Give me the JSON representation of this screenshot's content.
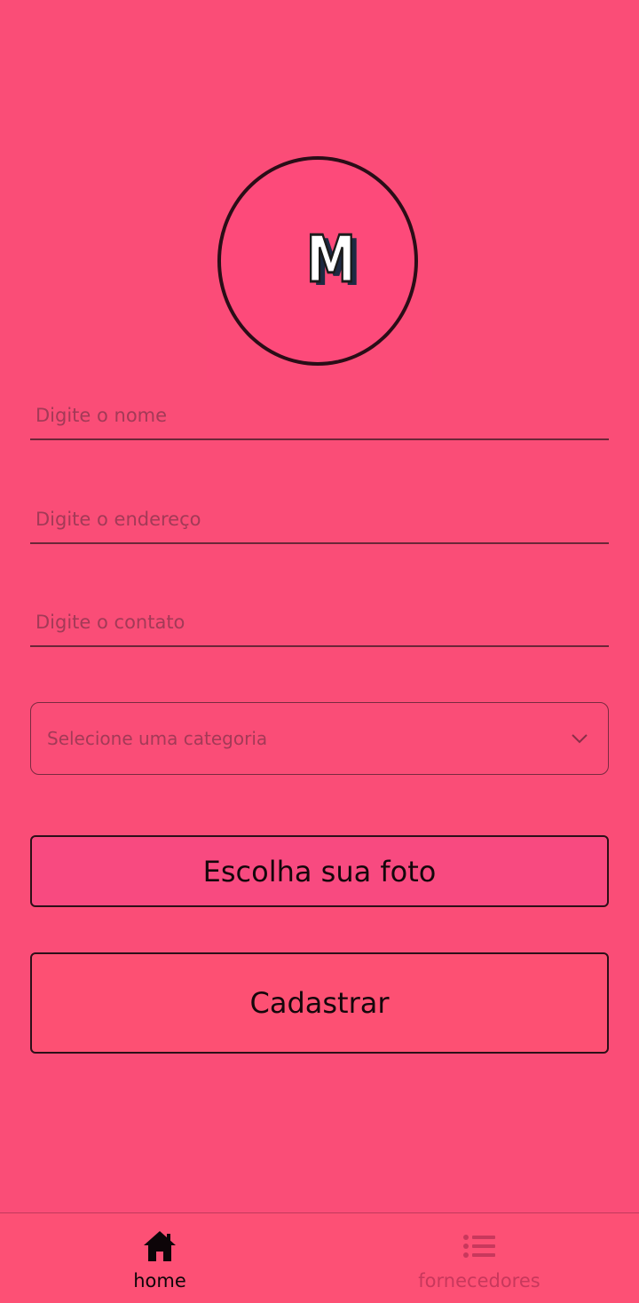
{
  "form": {
    "name_placeholder": "Digite o nome",
    "address_placeholder": "Digite o endereço",
    "contact_placeholder": "Digite o contato",
    "category_placeholder": "Selecione uma categoria",
    "photo_button": "Escolha sua foto",
    "submit_button": "Cadastrar"
  },
  "logo": {
    "letter": "M"
  },
  "tabs": [
    {
      "label": "home",
      "icon": "home-icon",
      "active": true
    },
    {
      "label": "fornecedores",
      "icon": "list-icon",
      "active": false
    }
  ],
  "colors": {
    "background": "#fa4d77",
    "photo_button": "#f84a80",
    "submit_button": "#fd5073",
    "tab_active": "#0d0508",
    "tab_inactive": "#c8385c"
  }
}
